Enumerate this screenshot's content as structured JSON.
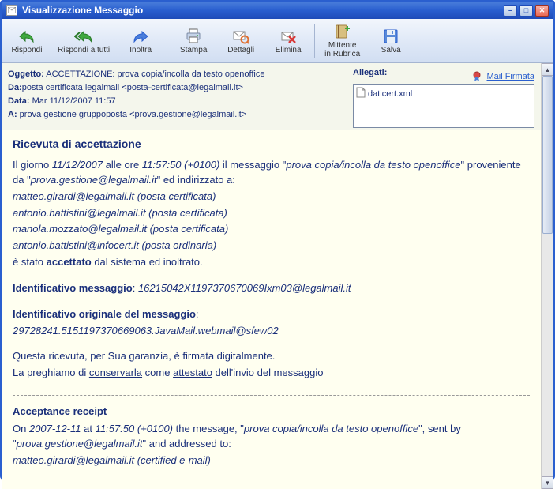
{
  "window": {
    "title": "Visualizzazione Messaggio"
  },
  "toolbar": {
    "reply": "Rispondi",
    "reply_all": "Rispondi a tutti",
    "forward": "Inoltra",
    "print": "Stampa",
    "details": "Dettagli",
    "delete": "Elimina",
    "addrbook_line1": "Mittente",
    "addrbook_line2": "in Rubrica",
    "save": "Salva"
  },
  "headers": {
    "subject_label": "Oggetto:",
    "subject": " ACCETTAZIONE: prova copia/incolla da testo openoffice",
    "from_label": "Da:",
    "from": "posta certificata legalmail <posta-certificata@legalmail.it>",
    "date_label": "Data:",
    "date": " Mar 11/12/2007 11:57",
    "to_label": "A:",
    "to": " prova gestione gruppoposta <prova.gestione@legalmail.it>"
  },
  "attachments": {
    "label": "Allegati:",
    "items": [
      "daticert.xml"
    ]
  },
  "signed": {
    "link": "Mail Firmata"
  },
  "body": {
    "h1": "Ricevuta di accettazione",
    "p1a": "Il giorno ",
    "p1b": "11/12/2007",
    "p1c": " alle ore ",
    "p1d": "11:57:50 (+0100)",
    "p1e": " il messaggio \"",
    "p1f": "prova copia/incolla da testo openoffice",
    "p1g": "\" proveniente da \"",
    "p1h": "prova.gestione@legalmail.it",
    "p1i": "\" ed indirizzato a:",
    "r1": "matteo.girardi@legalmail.it (posta certificata)",
    "r2": "antonio.battistini@legalmail.it (posta certificata)",
    "r3": "manola.mozzato@legalmail.it (posta certificata)",
    "r4": "antonio.battistini@infocert.it (posta ordinaria)",
    "p2a": "è stato ",
    "p2b": "accettato",
    "p2c": " dal sistema ed inoltrato.",
    "id_label": "Identificativo messaggio",
    "id_val": "16215042X1197370670069Ixm03@legalmail.it",
    "orig_label": "Identificativo originale del messaggio",
    "orig_val": "29728241.5151197370669063.JavaMail.webmail@sfew02",
    "g1": "Questa ricevuta, per Sua garanzia, è firmata digitalmente.",
    "g2a": "La preghiamo di ",
    "g2b": "conservarla",
    "g2c": " come ",
    "g2d": "attestato",
    "g2e": " dell'invio del messaggio",
    "en_h": "Acceptance receipt",
    "en1a": "On ",
    "en1b": "2007-12-11",
    "en1c": " at ",
    "en1d": "11:57:50 (+0100)",
    "en1e": " the message, \"",
    "en1f": "prova copia/incolla da testo openoffice",
    "en1g": "\", sent by \"",
    "en1h": "prova.gestione@legalmail.it",
    "en1i": "\" and addressed to:",
    "en_r1": "matteo.girardi@legalmail.it (certified e-mail)"
  }
}
